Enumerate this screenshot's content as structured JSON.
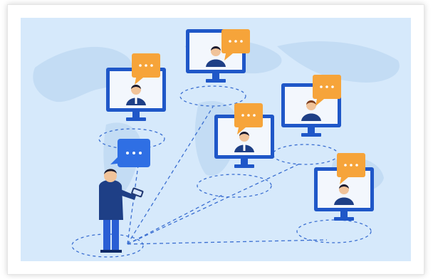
{
  "illustration": {
    "subject": "video-conference-network",
    "colors": {
      "background": "#d6e9fb",
      "map": "#c3dcf4",
      "monitor_frame": "#1f57c8",
      "monitor_screen": "#f3f7fd",
      "speech_bubble_orange": "#f6a43a",
      "speech_bubble_blue": "#2f6fe4",
      "person_suit": "#1e3f86",
      "dashed_lines": "#3b6fd1"
    },
    "icons": [
      "monitor-icon",
      "speech-bubble-icon",
      "person-avatar-icon",
      "smartphone-icon",
      "world-map-icon"
    ]
  }
}
